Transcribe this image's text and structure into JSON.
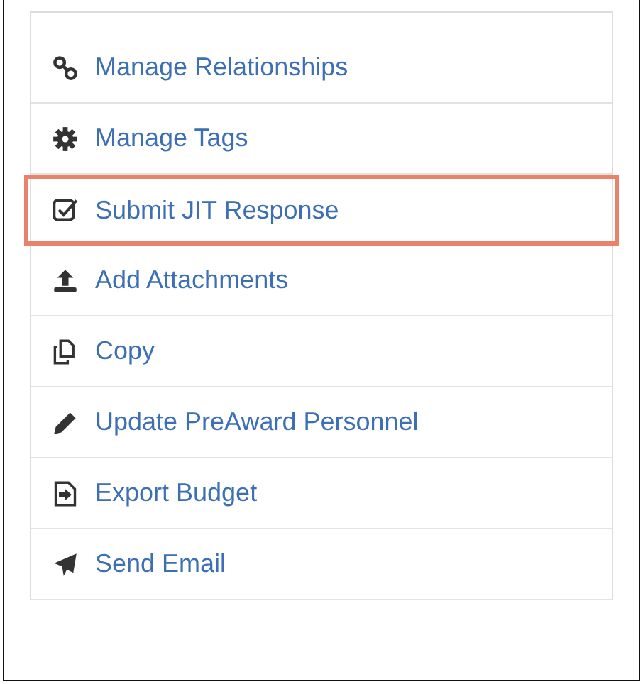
{
  "menu": {
    "items": [
      {
        "label": "Manage Relationships",
        "highlighted": false
      },
      {
        "label": "Manage Tags",
        "highlighted": false
      },
      {
        "label": "Submit JIT Response",
        "highlighted": true
      },
      {
        "label": "Add Attachments",
        "highlighted": false
      },
      {
        "label": "Copy",
        "highlighted": false
      },
      {
        "label": "Update PreAward Personnel",
        "highlighted": false
      },
      {
        "label": "Export Budget",
        "highlighted": false
      },
      {
        "label": "Send Email",
        "highlighted": false
      }
    ]
  }
}
